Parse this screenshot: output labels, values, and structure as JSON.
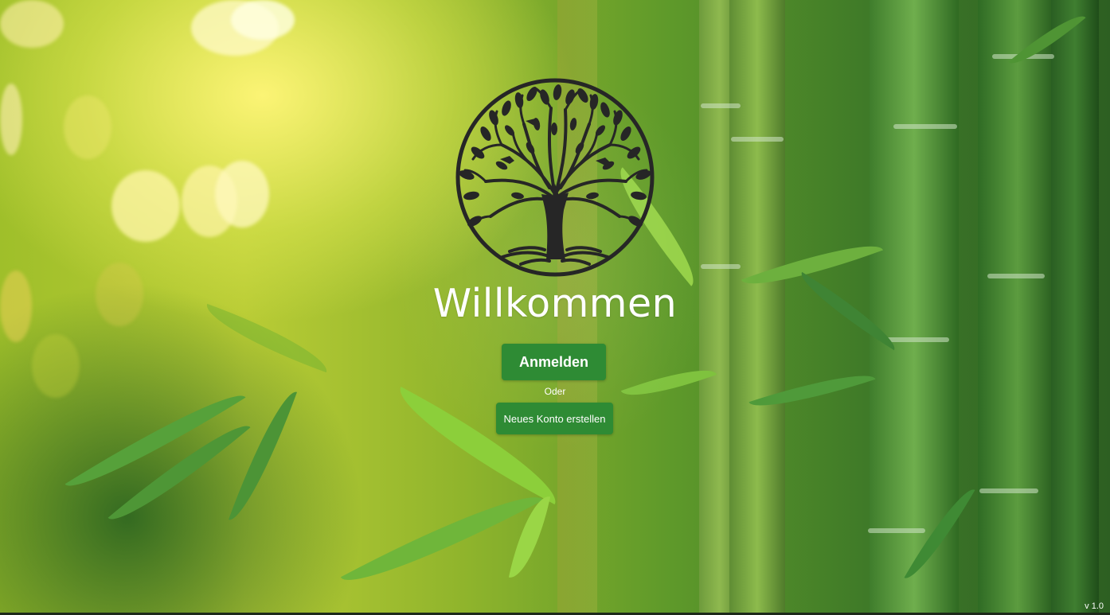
{
  "welcome": {
    "title": "Willkommen"
  },
  "actions": {
    "login_label": "Anmelden",
    "separator": "Oder",
    "register_label": "Neues Konto erstellen"
  },
  "footer": {
    "version": "v 1.0"
  },
  "logo": {
    "icon": "tree-of-life-icon",
    "color": "#262626"
  },
  "colors": {
    "button": "#2e8b34",
    "text": "#ffffff"
  }
}
